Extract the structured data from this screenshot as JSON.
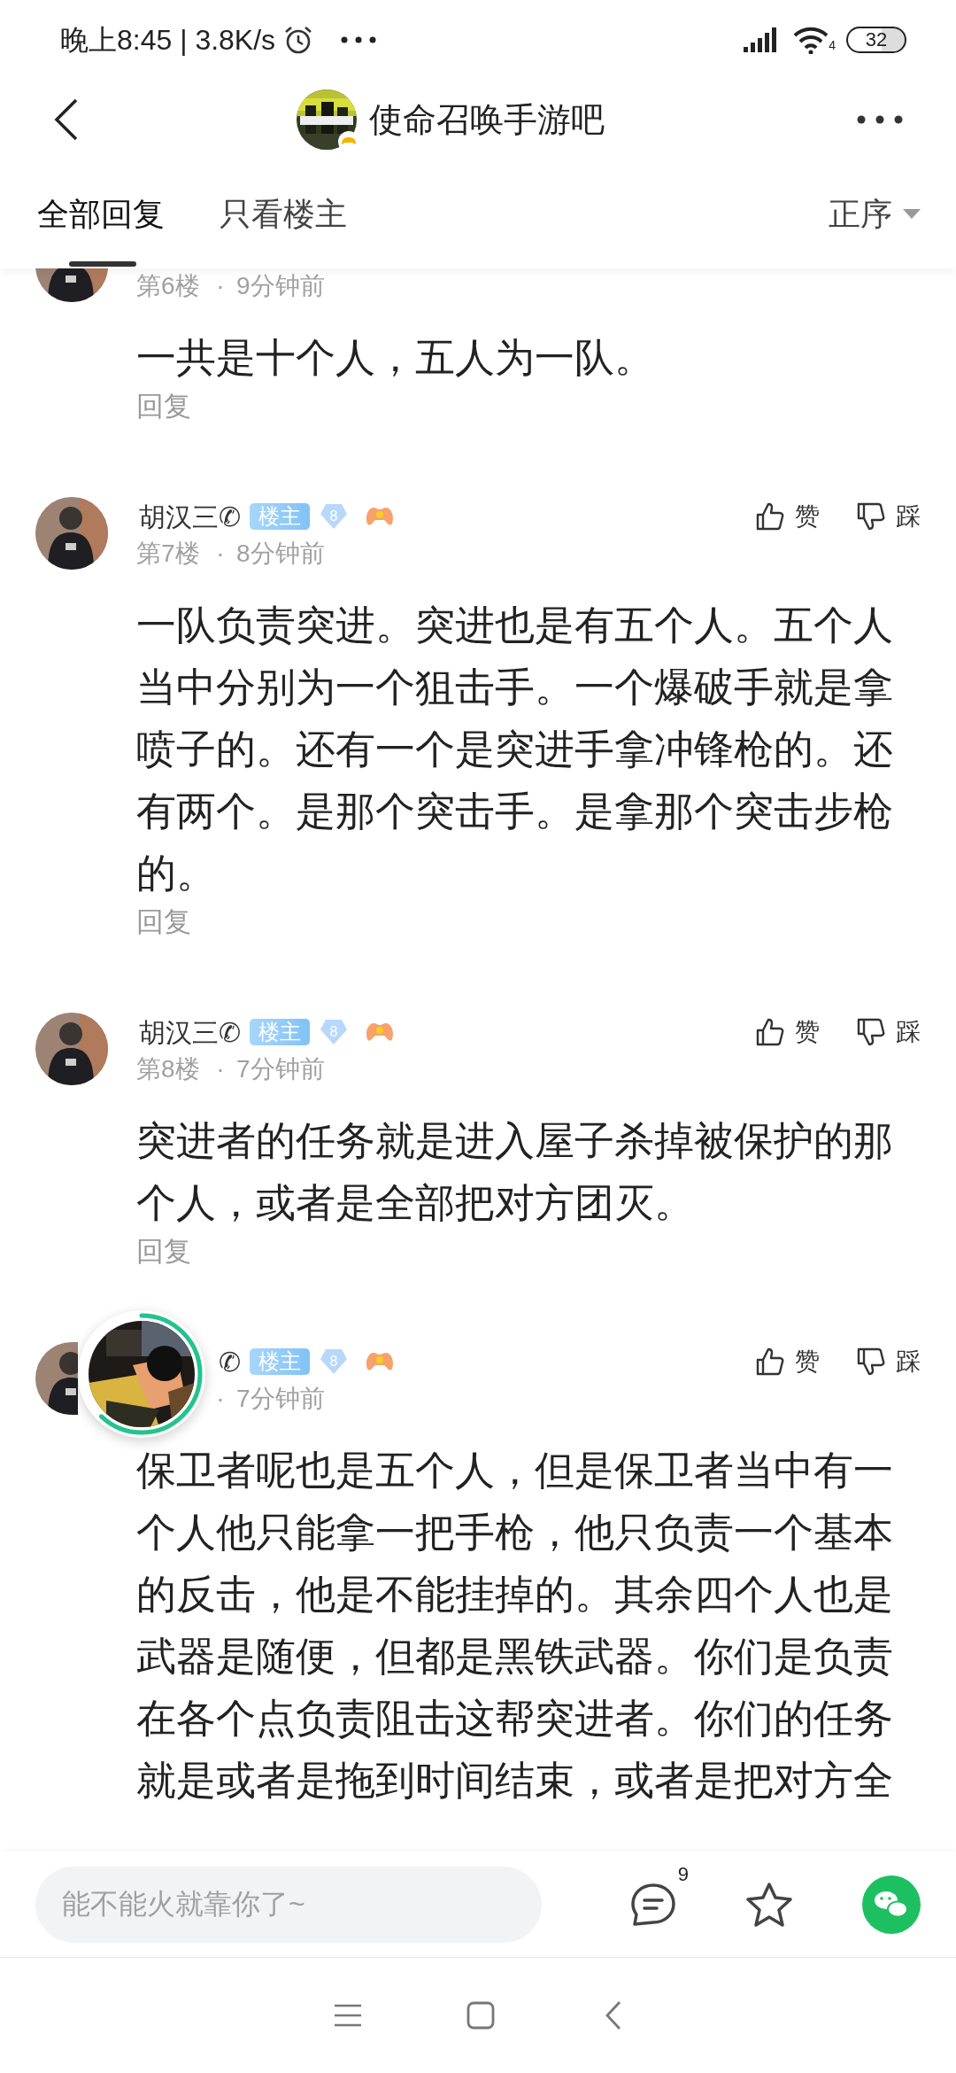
{
  "status_bar": {
    "time": "晚上8:45 | 3.8K/s",
    "wifi_label": "4",
    "battery": "32"
  },
  "header": {
    "title": "使命召唤手游吧"
  },
  "tabs": [
    {
      "label": "全部回复",
      "selected": true
    },
    {
      "label": "只看楼主",
      "selected": false
    }
  ],
  "sort": {
    "label": "正序"
  },
  "posts": [
    {
      "floor": "第6楼",
      "separator": "·",
      "time": "9分钟前",
      "content": "一共是十个人，五人为一队。",
      "reply": "回复"
    },
    {
      "name": "胡汉三✆",
      "op_badge": "楼主",
      "level_badge": "8",
      "floor": "第7楼",
      "separator": "·",
      "time": "8分钟前",
      "like": "赞",
      "dislike": "踩",
      "content": "一队负责突进。突进也是有五个人。五个人当中分别为一个狙击手。一个爆破手就是拿喷子的。还有一个是突进手拿冲锋枪的。还有两个。是那个突击手。是拿那个突击步枪的。",
      "reply": "回复"
    },
    {
      "name": "胡汉三✆",
      "op_badge": "楼主",
      "level_badge": "8",
      "floor": "第8楼",
      "separator": "·",
      "time": "7分钟前",
      "like": "赞",
      "dislike": "踩",
      "content": "突进者的任务就是进入屋子杀掉被保护的那个人，或者是全部把对方团灭。",
      "reply": "回复"
    },
    {
      "name": "✆",
      "op_badge": "楼主",
      "level_badge": "8",
      "separator": "·",
      "time": "7分钟前",
      "like": "赞",
      "dislike": "踩",
      "content": "保卫者呢也是五个人，但是保卫者当中有一个人他只能拿一把手枪，他只负责一个基本的反击，他是不能挂掉的。其余四个人也是武器是随便，但都是黑铁武器。你们是负责在各个点负责阻击这帮突进者。你们的任务就是或者是拖到时间结束，或者是把对方全"
    }
  ],
  "bottom_bar": {
    "placeholder": "能不能火就靠你了~",
    "comment_count": "9"
  }
}
